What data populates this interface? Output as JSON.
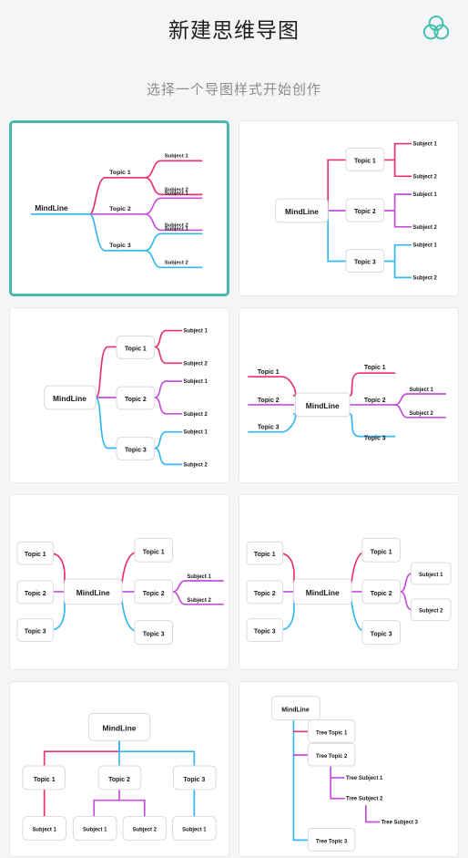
{
  "header": {
    "title": "新建思维导图",
    "logo_icon": "three-circles-venn-icon"
  },
  "subtitle": "选择一个导图样式开始创作",
  "colors": {
    "accent": "#4cb8ac",
    "branch_1": "#e8336b",
    "branch_2": "#c44fdb",
    "branch_3": "#34b7f1",
    "page_bg": "#f4f5f6",
    "card_bg": "#ffffff",
    "card_border": "#e7e8ea",
    "node_border": "#d9dade",
    "title_text": "#1d1d1f",
    "subtitle_text": "#8c8c8c"
  },
  "nodes": {
    "root": "MindLine",
    "topic1": "Topic 1",
    "topic2": "Topic 2",
    "topic3": "Topic 3",
    "subject1": "Subject 1",
    "subject2": "Subject 2",
    "tree_topic1": "Tree Topic 1",
    "tree_topic2": "Tree Topic 2",
    "tree_topic3": "Tree Topic 3",
    "tree_subject1": "Tree Subject 1",
    "tree_subject2": "Tree Subject 2",
    "tree_subject3": "Tree Subject 3"
  },
  "styles": [
    {
      "id": "style-1",
      "name": "right-logic-text-branches",
      "selected": true
    },
    {
      "id": "style-2",
      "name": "right-logic-boxed-topics-right-angle",
      "selected": false
    },
    {
      "id": "style-3",
      "name": "right-logic-boxed-topics-curved",
      "selected": false
    },
    {
      "id": "style-4",
      "name": "bilateral-text-branches",
      "selected": false
    },
    {
      "id": "style-5",
      "name": "bilateral-boxed-topics",
      "selected": false
    },
    {
      "id": "style-6",
      "name": "bilateral-all-boxed",
      "selected": false
    },
    {
      "id": "style-7",
      "name": "top-down-org-chart",
      "selected": false
    },
    {
      "id": "style-8",
      "name": "tree-outline",
      "selected": false
    }
  ]
}
